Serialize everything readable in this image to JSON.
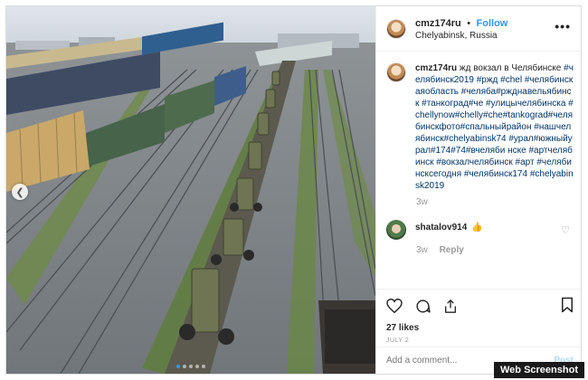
{
  "post": {
    "username": "cmz174ru",
    "separator": "•",
    "follow_label": "Follow",
    "location": "Chelyabinsk, Russia",
    "more_icon": "more-horizontal-icon",
    "caption_text": "жд вокзал в Челябинске",
    "hashtags": "#челябинск2019 #ржд #chel #челябинскаяобласть #челяба#ржднавельябинск #танкоград#че #улицычелябинска #chellynow#chelly#che#tankograd#челябинскфото#спальныйрайон #нашчелябинск#chelyabinsk74 #урал#южныйурал#174#74#вчеляби нске #артчелябинск #вокзалчелябинск #арт #челябинсксегодня #челябинск174 #chelyabinsk2019",
    "caption_age": "3w"
  },
  "comment": {
    "username": "shatalov914",
    "emoji": "👍",
    "age": "3w",
    "reply_label": "Reply",
    "like_icon": "heart-outline-icon"
  },
  "actions": {
    "likes": "27 likes",
    "date": "JULY 2",
    "icons": [
      "heart-icon",
      "comment-icon",
      "share-icon",
      "bookmark-icon"
    ]
  },
  "composer": {
    "placeholder": "Add a comment...",
    "post_label": "Post"
  },
  "carousel": {
    "prev_icon": "chevron-left-icon",
    "slides": 5,
    "active_slide": 1
  },
  "watermark": "Web Screenshot",
  "colors": {
    "accent": "#3897f0",
    "hashtag": "#003569",
    "muted": "#999999",
    "post_disabled": "#b3dbff"
  }
}
